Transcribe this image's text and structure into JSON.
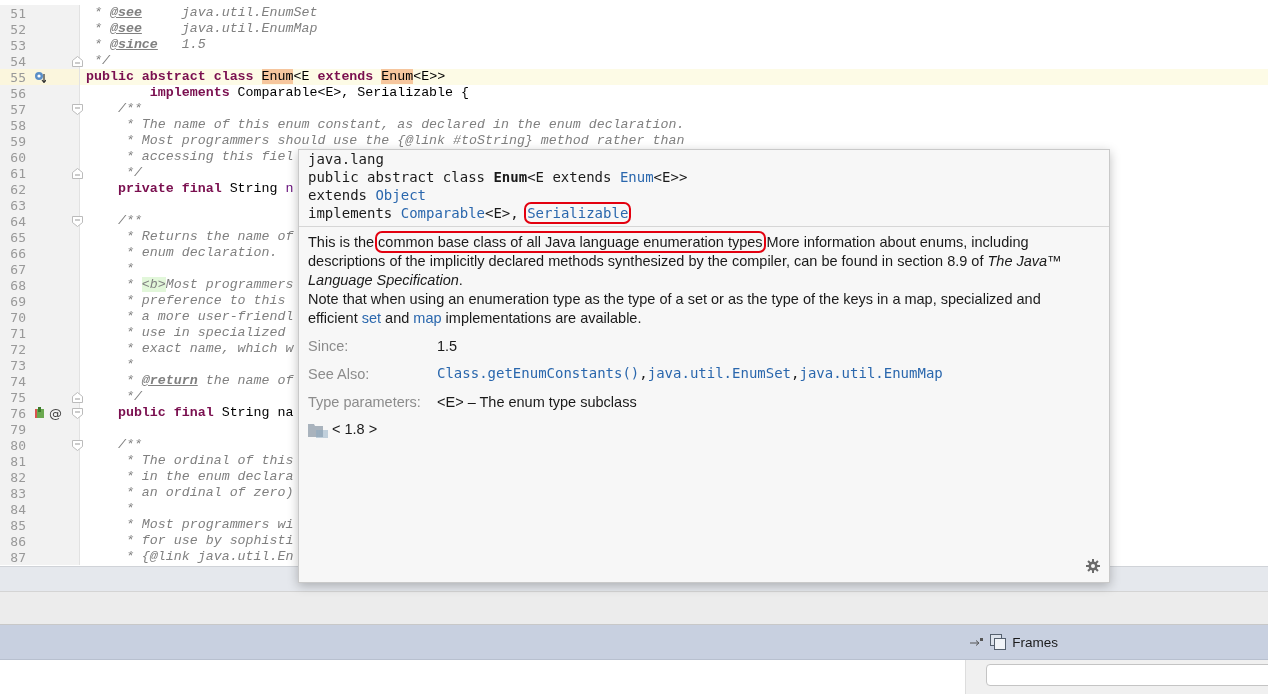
{
  "editor": {
    "lines": [
      {
        "number": "51",
        "current": false,
        "fold_start": false,
        "fold_end": false,
        "overriding": false,
        "implemented": false,
        "parts": [
          {
            "kind": "comment",
            "text": " * "
          },
          {
            "kind": "doctag",
            "text": "@see"
          },
          {
            "kind": "comment",
            "text": "     java.util.EnumSet"
          }
        ]
      },
      {
        "number": "52",
        "current": false,
        "fold_start": false,
        "fold_end": false,
        "overriding": false,
        "implemented": false,
        "parts": [
          {
            "kind": "comment",
            "text": " * "
          },
          {
            "kind": "doctag",
            "text": "@see"
          },
          {
            "kind": "comment",
            "text": "     java.util.EnumMap"
          }
        ]
      },
      {
        "number": "53",
        "current": false,
        "fold_start": false,
        "fold_end": false,
        "overriding": false,
        "implemented": false,
        "parts": [
          {
            "kind": "comment",
            "text": " * "
          },
          {
            "kind": "doctag",
            "text": "@since"
          },
          {
            "kind": "comment",
            "text": "   1.5"
          }
        ]
      },
      {
        "number": "54",
        "current": false,
        "fold_start": false,
        "fold_end": true,
        "overriding": false,
        "implemented": false,
        "parts": [
          {
            "kind": "comment",
            "text": " */"
          }
        ]
      },
      {
        "number": "55",
        "current": true,
        "fold_start": false,
        "fold_end": false,
        "overriding": true,
        "implemented": false,
        "parts": [
          {
            "kind": "keyword",
            "text": "public abstract class "
          },
          {
            "kind": "match",
            "text": "Enum"
          },
          {
            "kind": "plain",
            "text": "<E "
          },
          {
            "kind": "keyword",
            "text": "extends "
          },
          {
            "kind": "match",
            "text": "Enum"
          },
          {
            "kind": "plain",
            "text": "<E>>"
          }
        ]
      },
      {
        "number": "56",
        "current": false,
        "fold_start": false,
        "fold_end": false,
        "overriding": false,
        "implemented": false,
        "parts": [
          {
            "kind": "keyword",
            "text": "        implements "
          },
          {
            "kind": "plain",
            "text": "Comparable<E>, Serializable {"
          }
        ]
      },
      {
        "number": "57",
        "current": false,
        "fold_start": true,
        "fold_end": false,
        "overriding": false,
        "implemented": false,
        "parts": [
          {
            "kind": "comment",
            "text": "    /**"
          }
        ]
      },
      {
        "number": "58",
        "current": false,
        "fold_start": false,
        "fold_end": false,
        "overriding": false,
        "implemented": false,
        "parts": [
          {
            "kind": "comment",
            "text": "     * The name of this enum constant, as declared in the enum declaration."
          }
        ]
      },
      {
        "number": "59",
        "current": false,
        "fold_start": false,
        "fold_end": false,
        "overriding": false,
        "implemented": false,
        "parts": [
          {
            "kind": "comment",
            "text": "     * Most programmers should use the {@link #toString} method rather than"
          }
        ]
      },
      {
        "number": "60",
        "current": false,
        "fold_start": false,
        "fold_end": false,
        "overriding": false,
        "implemented": false,
        "parts": [
          {
            "kind": "comment",
            "text": "     * accessing this fiel"
          }
        ]
      },
      {
        "number": "61",
        "current": false,
        "fold_start": false,
        "fold_end": true,
        "overriding": false,
        "implemented": false,
        "parts": [
          {
            "kind": "comment",
            "text": "     */"
          }
        ]
      },
      {
        "number": "62",
        "current": false,
        "fold_start": false,
        "fold_end": false,
        "overriding": false,
        "implemented": false,
        "parts": [
          {
            "kind": "keyword",
            "text": "    private final "
          },
          {
            "kind": "plain",
            "text": "String "
          },
          {
            "kind": "field",
            "text": "n"
          }
        ]
      },
      {
        "number": "63",
        "current": false,
        "fold_start": false,
        "fold_end": false,
        "overriding": false,
        "implemented": false
      },
      {
        "number": "64",
        "current": false,
        "fold_start": true,
        "fold_end": false,
        "overriding": false,
        "implemented": false,
        "parts": [
          {
            "kind": "comment",
            "text": "    /**"
          }
        ]
      },
      {
        "number": "65",
        "current": false,
        "fold_start": false,
        "fold_end": false,
        "overriding": false,
        "implemented": false,
        "parts": [
          {
            "kind": "comment",
            "text": "     * Returns the name of"
          }
        ]
      },
      {
        "number": "66",
        "current": false,
        "fold_start": false,
        "fold_end": false,
        "overriding": false,
        "implemented": false,
        "parts": [
          {
            "kind": "comment",
            "text": "     * enum declaration."
          }
        ]
      },
      {
        "number": "67",
        "current": false,
        "fold_start": false,
        "fold_end": false,
        "overriding": false,
        "implemented": false,
        "parts": [
          {
            "kind": "comment",
            "text": "     *"
          }
        ]
      },
      {
        "number": "68",
        "current": false,
        "fold_start": false,
        "fold_end": false,
        "overriding": false,
        "implemented": false,
        "parts": [
          {
            "kind": "comment",
            "text": "     * "
          },
          {
            "kind": "htmltag",
            "text": "<b>"
          },
          {
            "kind": "comment",
            "text": "Most programmers"
          }
        ]
      },
      {
        "number": "69",
        "current": false,
        "fold_start": false,
        "fold_end": false,
        "overriding": false,
        "implemented": false,
        "parts": [
          {
            "kind": "comment",
            "text": "     * preference to this"
          }
        ]
      },
      {
        "number": "70",
        "current": false,
        "fold_start": false,
        "fold_end": false,
        "overriding": false,
        "implemented": false,
        "parts": [
          {
            "kind": "comment",
            "text": "     * a more user-friendl"
          }
        ]
      },
      {
        "number": "71",
        "current": false,
        "fold_start": false,
        "fold_end": false,
        "overriding": false,
        "implemented": false,
        "parts": [
          {
            "kind": "comment",
            "text": "     * use in specialized"
          }
        ]
      },
      {
        "number": "72",
        "current": false,
        "fold_start": false,
        "fold_end": false,
        "overriding": false,
        "implemented": false,
        "parts": [
          {
            "kind": "comment",
            "text": "     * exact name, which w"
          }
        ]
      },
      {
        "number": "73",
        "current": false,
        "fold_start": false,
        "fold_end": false,
        "overriding": false,
        "implemented": false,
        "parts": [
          {
            "kind": "comment",
            "text": "     *"
          }
        ]
      },
      {
        "number": "74",
        "current": false,
        "fold_start": false,
        "fold_end": false,
        "overriding": false,
        "implemented": false,
        "parts": [
          {
            "kind": "comment",
            "text": "     * "
          },
          {
            "kind": "doctag",
            "text": "@return"
          },
          {
            "kind": "comment",
            "text": " the name of"
          }
        ]
      },
      {
        "number": "75",
        "current": false,
        "fold_start": false,
        "fold_end": true,
        "overriding": false,
        "implemented": false,
        "parts": [
          {
            "kind": "comment",
            "text": "     */"
          }
        ]
      },
      {
        "number": "76",
        "current": false,
        "fold_start": true,
        "fold_end": false,
        "overriding": false,
        "implemented": true,
        "annotation": "@",
        "parts": [
          {
            "kind": "keyword",
            "text": "    public final "
          },
          {
            "kind": "plain",
            "text": "String na"
          }
        ]
      },
      {
        "number": "79",
        "current": false,
        "fold_start": false,
        "fold_end": false,
        "overriding": false,
        "implemented": false
      },
      {
        "number": "80",
        "current": false,
        "fold_start": true,
        "fold_end": false,
        "overriding": false,
        "implemented": false,
        "parts": [
          {
            "kind": "comment",
            "text": "    /**"
          }
        ]
      },
      {
        "number": "81",
        "current": false,
        "fold_start": false,
        "fold_end": false,
        "overriding": false,
        "implemented": false,
        "parts": [
          {
            "kind": "comment",
            "text": "     * The ordinal of this"
          }
        ]
      },
      {
        "number": "82",
        "current": false,
        "fold_start": false,
        "fold_end": false,
        "overriding": false,
        "implemented": false,
        "parts": [
          {
            "kind": "comment",
            "text": "     * in the enum declara"
          }
        ]
      },
      {
        "number": "83",
        "current": false,
        "fold_start": false,
        "fold_end": false,
        "overriding": false,
        "implemented": false,
        "parts": [
          {
            "kind": "comment",
            "text": "     * an ordinal of zero)"
          }
        ]
      },
      {
        "number": "84",
        "current": false,
        "fold_start": false,
        "fold_end": false,
        "overriding": false,
        "implemented": false,
        "parts": [
          {
            "kind": "comment",
            "text": "     *"
          }
        ]
      },
      {
        "number": "85",
        "current": false,
        "fold_start": false,
        "fold_end": false,
        "overriding": false,
        "implemented": false,
        "parts": [
          {
            "kind": "comment",
            "text": "     * Most programmers wi"
          }
        ]
      },
      {
        "number": "86",
        "current": false,
        "fold_start": false,
        "fold_end": false,
        "overriding": false,
        "implemented": false,
        "parts": [
          {
            "kind": "comment",
            "text": "     * for use by sophisti"
          }
        ]
      },
      {
        "number": "87",
        "current": false,
        "fold_start": false,
        "fold_end": false,
        "overriding": false,
        "implemented": false,
        "parts": [
          {
            "kind": "comment",
            "text": "     * {@link java.util.En"
          }
        ]
      }
    ]
  },
  "doc_popup": {
    "header": [
      [
        {
          "kind": "text",
          "text": "java.lang"
        }
      ],
      [
        {
          "kind": "text",
          "text": "public abstract class "
        },
        {
          "kind": "bold",
          "text": "Enum"
        },
        {
          "kind": "text",
          "text": "<E extends "
        },
        {
          "kind": "link",
          "text": "Enum"
        },
        {
          "kind": "text",
          "text": "<E>>"
        }
      ],
      [
        {
          "kind": "text",
          "text": "extends "
        },
        {
          "kind": "link",
          "text": "Object"
        }
      ],
      [
        {
          "kind": "text",
          "text": "implements "
        },
        {
          "kind": "link",
          "text": "Comparable"
        },
        {
          "kind": "text",
          "text": "<E>, "
        },
        {
          "kind": "link",
          "text": "Serializable",
          "annotated": true
        }
      ]
    ],
    "description": [
      [
        {
          "kind": "text",
          "text": "This is the "
        },
        {
          "kind": "text",
          "text": "common base class of all Java language enumeration types",
          "annotated": true
        },
        {
          "kind": "text",
          "text": " More information about enums, including descriptions of the implicitly declared methods synthesized by the compiler, can be found in section 8.9 of "
        },
        {
          "kind": "italic",
          "text": "The Java™ Language Specification"
        },
        {
          "kind": "text",
          "text": "."
        }
      ],
      [
        {
          "kind": "text",
          "text": "Note that when using an enumeration type as the type of a set or as the type of the keys in a map, specialized and efficient "
        },
        {
          "kind": "link",
          "text": "set"
        },
        {
          "kind": "text",
          "text": " and "
        },
        {
          "kind": "link",
          "text": "map"
        },
        {
          "kind": "text",
          "text": " implementations are available."
        }
      ]
    ],
    "fields": [
      {
        "label": "Since:",
        "values": [
          {
            "kind": "text",
            "text": "1.5"
          }
        ]
      },
      {
        "label": "See Also:",
        "values": [
          {
            "kind": "codelink",
            "text": "Class.getEnumConstants()",
            "separator": ","
          },
          {
            "kind": "codelink",
            "text": "java.util.EnumSet",
            "separator": ","
          },
          {
            "kind": "codelink",
            "text": "java.util.EnumMap"
          }
        ]
      },
      {
        "label": "Type parameters:",
        "values": [
          {
            "kind": "text",
            "text": "<E> – The enum type subclass"
          }
        ]
      }
    ],
    "library": "< 1.8 >"
  },
  "bottom": {
    "frames_title": "Frames"
  }
}
